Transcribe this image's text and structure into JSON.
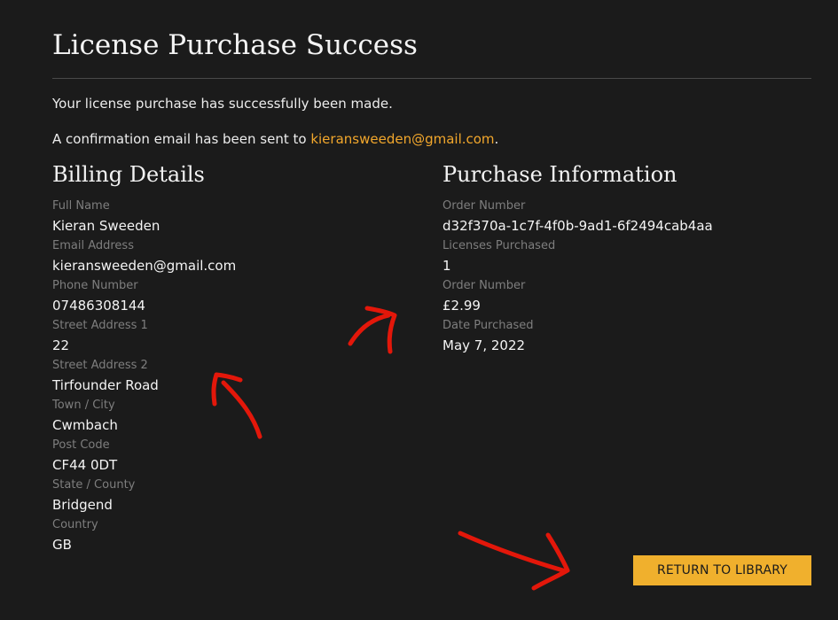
{
  "page": {
    "title": "License Purchase Success",
    "message": "Your license purchase has successfully been made.",
    "confirmation_prefix": "A confirmation email has been sent to ",
    "confirmation_email": "kieransweeden@gmail.com",
    "confirmation_suffix": "."
  },
  "billing": {
    "heading": "Billing Details",
    "fields": [
      {
        "label": "Full Name",
        "value": "Kieran Sweeden"
      },
      {
        "label": "Email Address",
        "value": "kieransweeden@gmail.com"
      },
      {
        "label": "Phone Number",
        "value": "07486308144"
      },
      {
        "label": "Street Address 1",
        "value": "22"
      },
      {
        "label": "Street Address 2",
        "value": "Tirfounder Road"
      },
      {
        "label": "Town / City",
        "value": "Cwmbach"
      },
      {
        "label": "Post Code",
        "value": "CF44 0DT"
      },
      {
        "label": "State / County",
        "value": "Bridgend"
      },
      {
        "label": "Country",
        "value": "GB"
      }
    ]
  },
  "purchase": {
    "heading": "Purchase Information",
    "fields": [
      {
        "label": "Order Number",
        "value": "d32f370a-1c7f-4f0b-9ad1-6f2494cab4aa"
      },
      {
        "label": "Licenses Purchased",
        "value": "1"
      },
      {
        "label": "Order Number",
        "value": "£2.99"
      },
      {
        "label": "Date Purchased",
        "value": "May 7, 2022"
      }
    ]
  },
  "actions": {
    "return_label": "RETURN TO LIBRARY"
  },
  "colors": {
    "background": "#1b1b1b",
    "accent": "#f0b02d",
    "link": "#f2a72c",
    "annotation": "#e3170a"
  }
}
